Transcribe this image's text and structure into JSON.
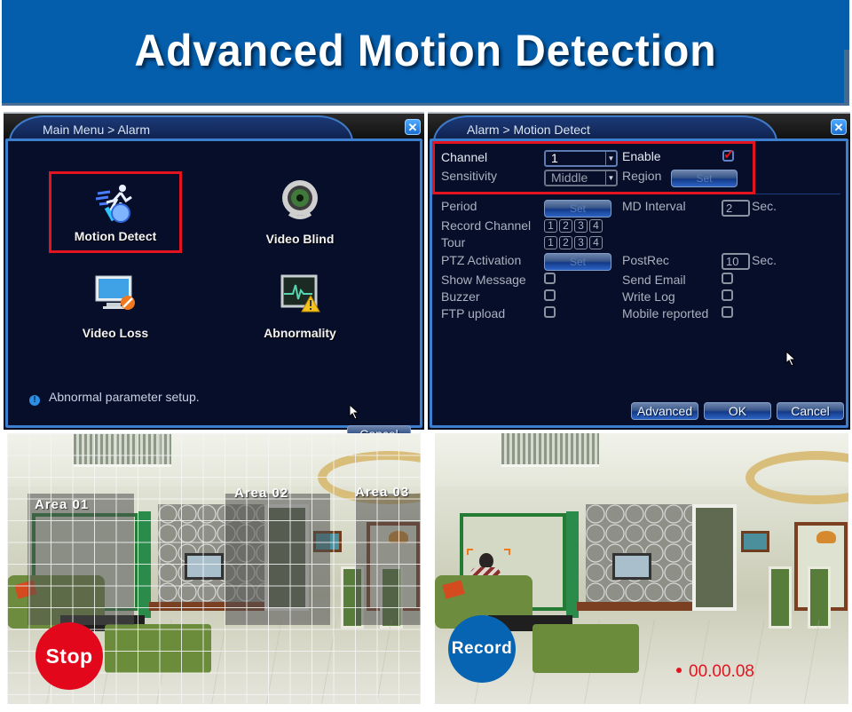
{
  "banner": {
    "title": "Advanced Motion Detection"
  },
  "alarm_menu": {
    "breadcrumb": "Main Menu > Alarm",
    "close_icon": "close-icon",
    "items": [
      {
        "label": "Motion Detect",
        "icon": "running-man-icon",
        "selected": true
      },
      {
        "label": "Video Blind",
        "icon": "eye-camera-icon",
        "selected": false
      },
      {
        "label": "Video Loss",
        "icon": "monitor-no-signal-icon",
        "selected": false
      },
      {
        "label": "Abnormality",
        "icon": "heartbeat-warning-icon",
        "selected": false
      }
    ],
    "info_text": "Abnormal parameter setup.",
    "cancel_label": "Cancel"
  },
  "motion_detect": {
    "breadcrumb": "Alarm > Motion Detect",
    "close_icon": "close-icon",
    "channel": {
      "label": "Channel",
      "value": "1"
    },
    "enable": {
      "label": "Enable",
      "checked": true
    },
    "sensitivity": {
      "label": "Sensitivity",
      "value": "Middle"
    },
    "region": {
      "label": "Region",
      "button": "Set"
    },
    "period": {
      "label": "Period",
      "button": "Set"
    },
    "md_interval": {
      "label": "MD Interval",
      "value": "2",
      "unit": "Sec."
    },
    "record_channel": {
      "label": "Record Channel",
      "channels": [
        "1",
        "2",
        "3",
        "4"
      ]
    },
    "tour": {
      "label": "Tour",
      "channels": [
        "1",
        "2",
        "3",
        "4"
      ]
    },
    "ptz_activation": {
      "label": "PTZ Activation",
      "button": "Set"
    },
    "postrec": {
      "label": "PostRec",
      "value": "10",
      "unit": "Sec."
    },
    "show_message": {
      "label": "Show Message",
      "checked": false
    },
    "send_email": {
      "label": "Send Email",
      "checked": false
    },
    "buzzer": {
      "label": "Buzzer",
      "checked": false
    },
    "write_log": {
      "label": "Write Log",
      "checked": false
    },
    "ftp_upload": {
      "label": "FTP upload",
      "checked": false
    },
    "mobile_reported": {
      "label": "Mobile reported",
      "checked": false
    },
    "buttons": {
      "advanced": "Advanced",
      "ok": "OK",
      "cancel": "Cancel"
    }
  },
  "scene_stop": {
    "areas": [
      "Area 01",
      "Area 02",
      "Area 03"
    ],
    "badge": "Stop",
    "badge_color": "#e3071c"
  },
  "scene_record": {
    "badge": "Record",
    "badge_color": "#0764b3",
    "timer": "00.00.08",
    "timer_color": "#e3141f"
  }
}
